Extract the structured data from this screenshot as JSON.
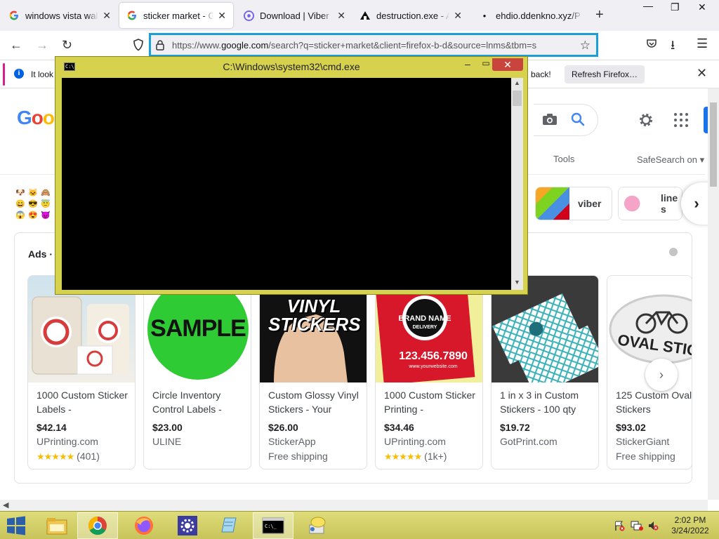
{
  "browser": {
    "tabs": [
      {
        "title": "windows vista wallpa",
        "favicon": "google-icon"
      },
      {
        "title": "sticker market - Goo",
        "favicon": "google-icon",
        "active": true
      },
      {
        "title": "Download | Viber",
        "favicon": "viber-icon"
      },
      {
        "title": "destruction.exe - And",
        "favicon": "site-icon"
      },
      {
        "title": "ehdio.ddenkno.xyz/P",
        "favicon": "blank-icon"
      }
    ],
    "new_tab": "+",
    "url_prefix": "https://www.",
    "url_host": "google.com",
    "url_rest": "/search?q=sticker+market&client=firefox-b-d&source=lnms&tbm=s",
    "notification": {
      "message_start": "It look",
      "message_end": "back!",
      "button": "Refresh Firefox…"
    }
  },
  "google": {
    "logo": "Goo",
    "tools": "Tools",
    "safesearch": "SafeSearch on ▾",
    "chips": [
      {
        "label": "viber"
      },
      {
        "label": "line s"
      }
    ],
    "emoji_chip": [
      "🐶",
      "🐱",
      "🙈",
      "😄",
      "😎",
      "😇",
      "😱",
      "😍",
      "😈"
    ],
    "ads_label": "Ads ·",
    "ads": [
      {
        "title": "1000 Custom Sticker Labels -",
        "price": "$42.14",
        "merchant": "UPrinting.com",
        "rating_stars": "★★★★★",
        "rating_count": "(401)"
      },
      {
        "title": "Circle Inventory Control Labels -",
        "price": "$23.00",
        "merchant": "ULINE",
        "image_text": "SAMPLE"
      },
      {
        "title": "Custom Glossy Vinyl Stickers - Your",
        "price": "$26.00",
        "merchant": "StickerApp",
        "extra": "Free shipping",
        "image_text": "VINYL STICKERS"
      },
      {
        "title": "1000 Custom Sticker Printing -",
        "price": "$34.46",
        "merchant": "UPrinting.com",
        "rating_stars": "★★★★★",
        "rating_count": "(1k+)",
        "image_text_1": "BRAND NAME",
        "image_text_2": "DELIVERY",
        "image_text_3": "123.456.7890",
        "image_text_4": "www.yourwebsite.com"
      },
      {
        "title": "1 in x 3 in Custom Stickers - 100 qty",
        "price": "$19.72",
        "merchant": "GotPrint.com"
      },
      {
        "title": "125 Custom Oval Stickers",
        "price": "$93.02",
        "merchant": "StickerGiant",
        "extra": "Free shipping",
        "image_text": "OVAL STICKE"
      }
    ]
  },
  "cmd": {
    "title": "C:\\Windows\\system32\\cmd.exe",
    "icon_text": "C:\\"
  },
  "taskbar": {
    "time": "2:02 PM",
    "date": "3/24/2022"
  },
  "colors": {
    "cmd_frame": "#d6d24e",
    "taskbar": "#d2cf66",
    "url_focus": "#1aa0d8",
    "google_blue": "#1a73e8"
  }
}
